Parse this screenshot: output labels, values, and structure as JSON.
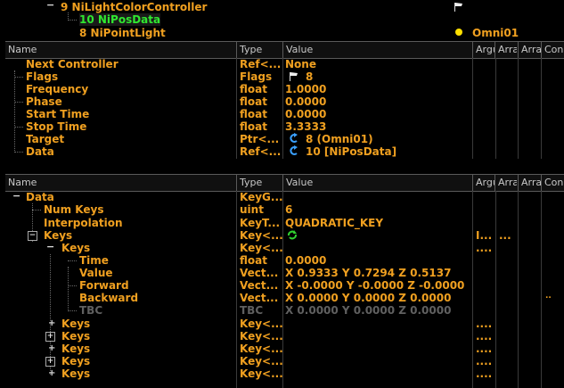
{
  "top_tree": {
    "item0": "9 NiLightColorController",
    "item1": "10 NiPosData",
    "item2": "8 NiPointLight",
    "item2_value": "Omni01"
  },
  "panel1": {
    "headers": [
      "Name",
      "Type",
      "Value",
      "Argu",
      "Arra",
      "Arra",
      "Con"
    ],
    "rows": [
      {
        "name": "Next Controller",
        "type": "Ref<...",
        "value": "None"
      },
      {
        "name": "Flags",
        "type": "Flags",
        "value": "8"
      },
      {
        "name": "Frequency",
        "type": "float",
        "value": "1.0000"
      },
      {
        "name": "Phase",
        "type": "float",
        "value": "0.0000"
      },
      {
        "name": "Start Time",
        "type": "float",
        "value": "0.0000"
      },
      {
        "name": "Stop Time",
        "type": "float",
        "value": "3.3333"
      },
      {
        "name": "Target",
        "type": "Ptr<...",
        "value": "8 (Omni01)"
      },
      {
        "name": "Data",
        "type": "Ref<...",
        "value": "10 [NiPosData]"
      }
    ]
  },
  "panel2": {
    "headers": [
      "Name",
      "Type",
      "Value",
      "Argu",
      "Arra",
      "Arra",
      "Con"
    ],
    "rows": [
      {
        "name": "Data",
        "type": "KeyG...",
        "value": "",
        "arg": "",
        "arr": ""
      },
      {
        "name": "Num Keys",
        "type": "uint",
        "value": "6",
        "arg": "",
        "arr": ""
      },
      {
        "name": "Interpolation",
        "type": "KeyT...",
        "value": "QUADRATIC_KEY",
        "arg": "",
        "arr": ""
      },
      {
        "name": "Keys",
        "type": "Key<...",
        "value": "",
        "arg": "I...",
        "arr": "..."
      },
      {
        "name": "Keys",
        "type": "Key<...",
        "value": "",
        "arg": "....",
        "arr": ""
      },
      {
        "name": "Time",
        "type": "float",
        "value": "0.0000",
        "arg": "",
        "arr": ""
      },
      {
        "name": "Value",
        "type": "Vect...",
        "value": "X 0.9333 Y 0.7294 Z 0.5137",
        "arg": "",
        "arr": ""
      },
      {
        "name": "Forward",
        "type": "Vect...",
        "value": "X -0.0000 Y -0.0000 Z -0.0000",
        "arg": "",
        "arr": ""
      },
      {
        "name": "Backward",
        "type": "Vect...",
        "value": "X 0.0000 Y 0.0000 Z 0.0000",
        "arg": "",
        "arr": ""
      },
      {
        "name": "TBC",
        "type": "TBC",
        "value": "X 0.0000 Y 0.0000 Z 0.0000",
        "arg": "",
        "arr": ""
      },
      {
        "name": "Keys",
        "type": "Key<...",
        "value": "",
        "arg": "....",
        "arr": ""
      },
      {
        "name": "Keys",
        "type": "Key<...",
        "value": "",
        "arg": "....",
        "arr": ""
      },
      {
        "name": "Keys",
        "type": "Key<...",
        "value": "",
        "arg": "....",
        "arr": ""
      },
      {
        "name": "Keys",
        "type": "Key<...",
        "value": "",
        "arg": "....",
        "arr": ""
      },
      {
        "name": "Keys",
        "type": "Key<...",
        "value": "",
        "arg": "....",
        "arr": ""
      }
    ]
  },
  "colors": {
    "text": "#f0a020",
    "green": "#30e830",
    "disabled": "#606060",
    "background": "#000000"
  },
  "icons": [
    "flag-icon",
    "bulb-icon",
    "link-icon",
    "refresh-icon"
  ]
}
